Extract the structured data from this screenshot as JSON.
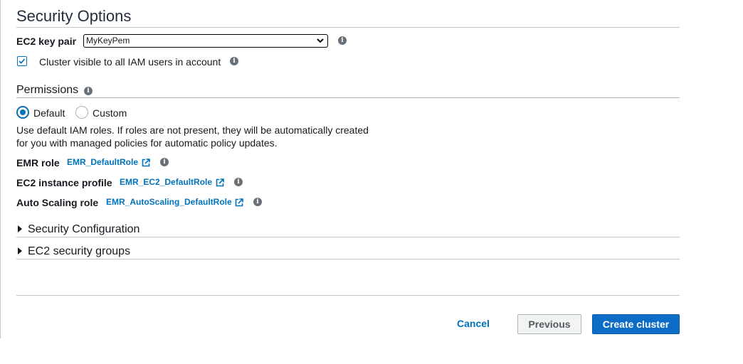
{
  "section": {
    "title": "Security Options"
  },
  "key_pair": {
    "label": "EC2 key pair",
    "selected": "MyKeyPem"
  },
  "visibility": {
    "label": "Cluster visible to all IAM users in account",
    "checked": true
  },
  "permissions": {
    "title": "Permissions",
    "options": [
      {
        "label": "Default",
        "selected": true
      },
      {
        "label": "Custom",
        "selected": false
      }
    ],
    "description_line1": "Use default IAM roles. If roles are not present, they will be automatically created",
    "description_line2": "for you with managed policies for automatic policy updates.",
    "roles": [
      {
        "label": "EMR role",
        "value": "EMR_DefaultRole"
      },
      {
        "label": "EC2 instance profile",
        "value": "EMR_EC2_DefaultRole"
      },
      {
        "label": "Auto Scaling role",
        "value": "EMR_AutoScaling_DefaultRole"
      }
    ]
  },
  "expanders": [
    {
      "label": "Security Configuration"
    },
    {
      "label": "EC2 security groups"
    }
  ],
  "footer": {
    "cancel": "Cancel",
    "previous": "Previous",
    "create": "Create cluster"
  },
  "colors": {
    "accent": "#0073bb",
    "primary_button": "#0d6cc6",
    "info_icon": "#687078"
  }
}
